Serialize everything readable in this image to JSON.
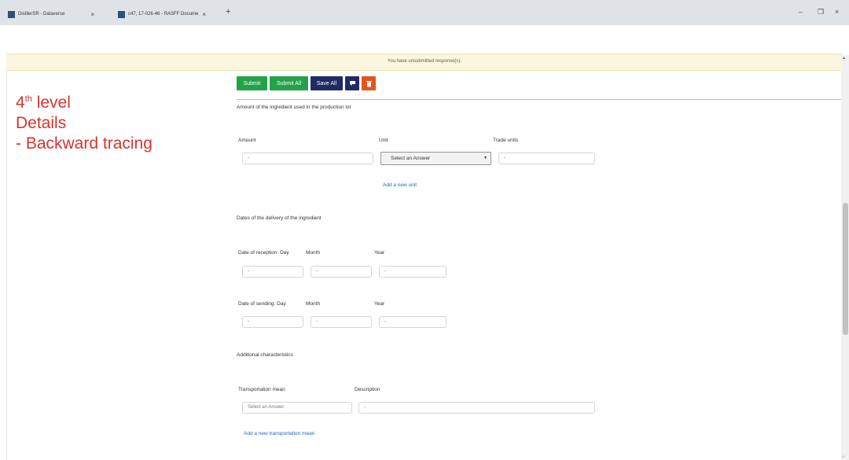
{
  "browser": {
    "tabs": [
      {
        "label": "DistilerSR - Dataverse",
        "close": "×"
      },
      {
        "label": "c47, 17-026-46 - RASFF Docume",
        "close": "×"
      }
    ],
    "new_tab": "+",
    "window_controls": {
      "minimize": "–",
      "restore": "❐",
      "close": "×"
    }
  },
  "banner": {
    "text": "You have unsubmitted response(s)."
  },
  "heading": {
    "line1_num": "4",
    "line1_sup": "th",
    "line1_rest": " level",
    "line2": "Details",
    "line3": "- Backward tracing"
  },
  "toolbar": {
    "submit": "Submit",
    "submit_all": "Submit All",
    "save_all": "Save All",
    "comment_icon": "comment-icon",
    "delete_icon": "trash-icon",
    "colors": {
      "green": "#22a34a",
      "navy": "#1f2c64",
      "orange": "#e0561f"
    }
  },
  "amount_section": {
    "title": "Amount of the ingredient used in the production lot",
    "amount_label": "Amount",
    "amount_value": "-",
    "unit_label": "Unit",
    "unit_selected": "Select an Answer",
    "trade_units_label": "Trade units",
    "trade_units_value": "-",
    "add_unit_link": "Add a new unit"
  },
  "dates_section": {
    "title": "Dates of the delivery of the ingredient",
    "reception_label": "Date of reception: Day",
    "sending_label": "Date of sending: Day",
    "month_label": "Month",
    "year_label": "Year",
    "reception_day": "-",
    "reception_month": "-",
    "reception_year": "-",
    "sending_day": "-",
    "sending_month": "-",
    "sending_year": "-"
  },
  "additional_section": {
    "title": "Additional characteristics",
    "transport_label": "Transportation mean",
    "transport_placeholder": "Select an Answer",
    "description_label": "Description",
    "description_value": "-",
    "add_transport_link": "Add a new transportation mean"
  }
}
